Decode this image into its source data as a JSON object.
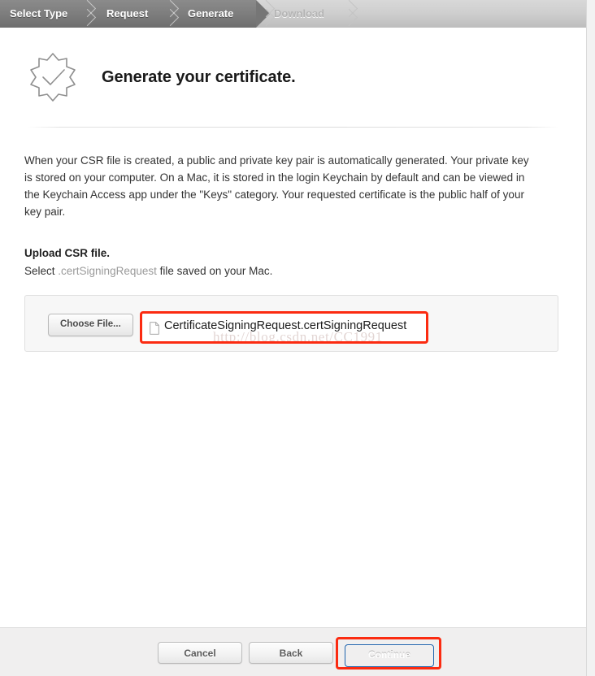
{
  "stepbar": {
    "steps": [
      {
        "label": "Select Type",
        "state": "done"
      },
      {
        "label": "Request",
        "state": "done"
      },
      {
        "label": "Generate",
        "state": "current"
      },
      {
        "label": "Download",
        "state": "upcoming"
      }
    ]
  },
  "header": {
    "title": "Generate your certificate.",
    "icon": "certificate-badge-check-icon"
  },
  "main": {
    "intro": "When your CSR file is created, a public and private key pair is automatically generated. Your private key is stored on your computer. On a Mac, it is stored in the login Keychain by default and can be viewed in the Keychain Access app under the \"Keys\" category. Your requested certificate is the public half of your key pair.",
    "upload_heading": "Upload CSR file.",
    "upload_sub_prefix": "Select ",
    "upload_sub_highlight": ".certSigningRequest",
    "upload_sub_suffix": " file saved on your Mac.",
    "choose_file_label": "Choose File...",
    "file_name": "CertificateSigningRequest.certSigningRequest",
    "file_icon": "document-icon",
    "watermark": "http://blog.csdn.net/CC1991_"
  },
  "footer": {
    "cancel_label": "Cancel",
    "back_label": "Back",
    "continue_label": "Continue"
  },
  "colors": {
    "highlight_red": "#fb2b11",
    "primary_blue": "#2f86d8",
    "stepbar_active": "#767676",
    "muted_text": "#9a9a9a"
  }
}
